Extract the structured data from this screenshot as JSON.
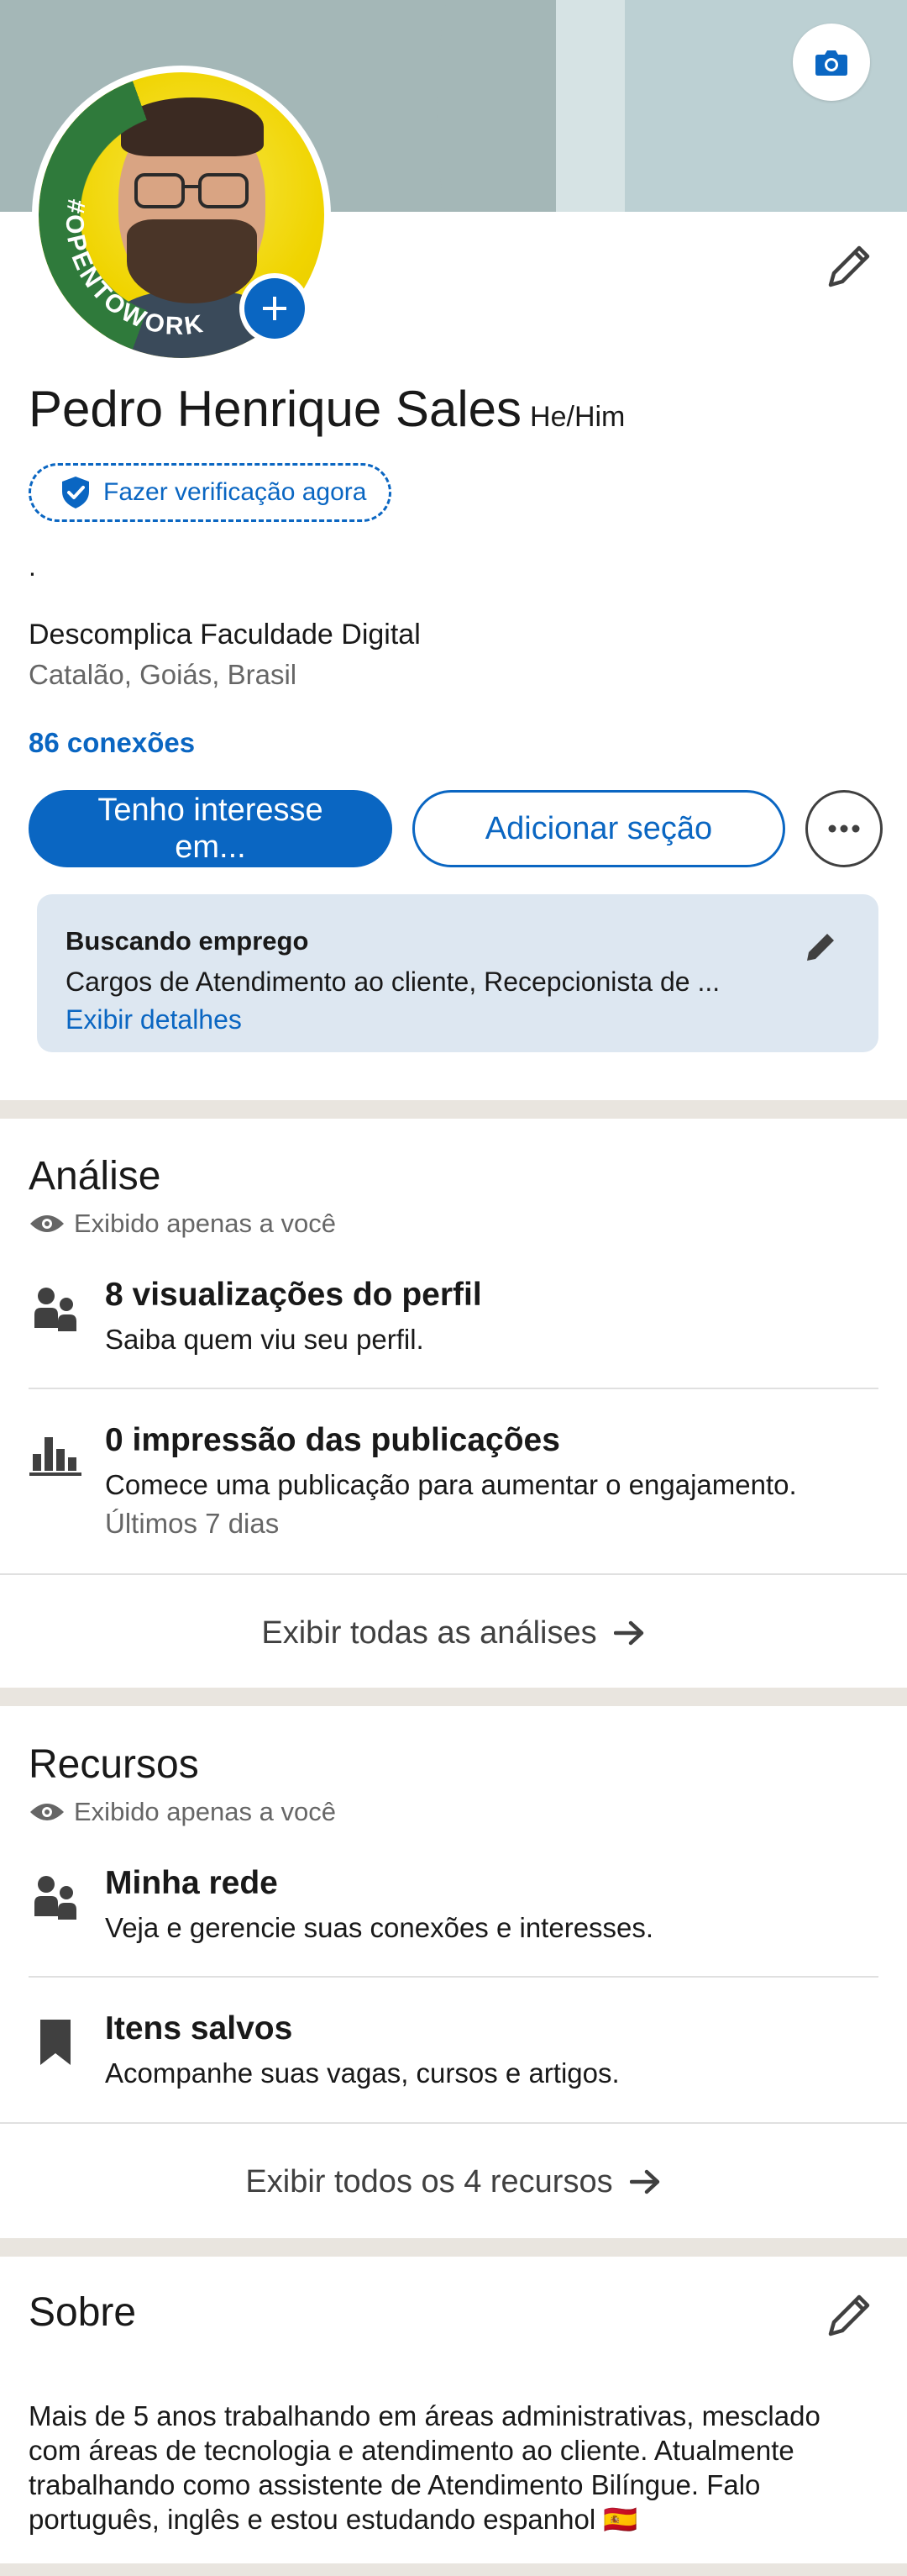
{
  "profile": {
    "name": "Pedro Henrique Sales",
    "pronouns": "He/Him",
    "verify_label": "Fazer verificação agora",
    "headline": ".",
    "school": "Descomplica Faculdade Digital",
    "location": "Catalão, Goiás, Brasil",
    "connections": "86 conexões",
    "open_to_work_badge": "#OPENTOWORK"
  },
  "actions": {
    "primary_label": "Tenho interesse em...",
    "add_section_label": "Adicionar seção"
  },
  "job_search": {
    "title": "Buscando emprego",
    "description": "Cargos de Atendimento ao cliente, Recepcionista de ...",
    "details_link": "Exibir detalhes"
  },
  "analytics": {
    "title": "Análise",
    "visibility": "Exibido apenas a você",
    "items": [
      {
        "title": "8 visualizações do perfil",
        "subtitle": "Saiba quem viu seu perfil.",
        "icon": "people-icon"
      },
      {
        "title": "0 impressão das publicações",
        "subtitle": "Comece uma publicação para aumentar o engajamento.",
        "note": "Últimos 7 dias",
        "icon": "bar-chart-icon"
      }
    ],
    "show_all": "Exibir todas as análises"
  },
  "resources": {
    "title": "Recursos",
    "visibility": "Exibido apenas a você",
    "items": [
      {
        "title": "Minha rede",
        "subtitle": "Veja e gerencie suas conexões e interesses.",
        "icon": "people-icon"
      },
      {
        "title": "Itens salvos",
        "subtitle": "Acompanhe suas vagas, cursos e artigos.",
        "icon": "bookmark-icon"
      }
    ],
    "show_all": "Exibir todos os 4 recursos"
  },
  "about": {
    "title": "Sobre",
    "text": "Mais de 5 anos trabalhando em áreas administrativas, mesclado com áreas de tecnologia e atendimento ao cliente. Atualmente trabalhando como assistente de Atendimento Bilíngue. Falo português, inglês e estou estudando espanhol 🇪🇸"
  },
  "colors": {
    "brand_blue": "#0a66c2",
    "open_to_work_green": "#2f7a3b",
    "job_card_bg": "#dde7f1"
  }
}
